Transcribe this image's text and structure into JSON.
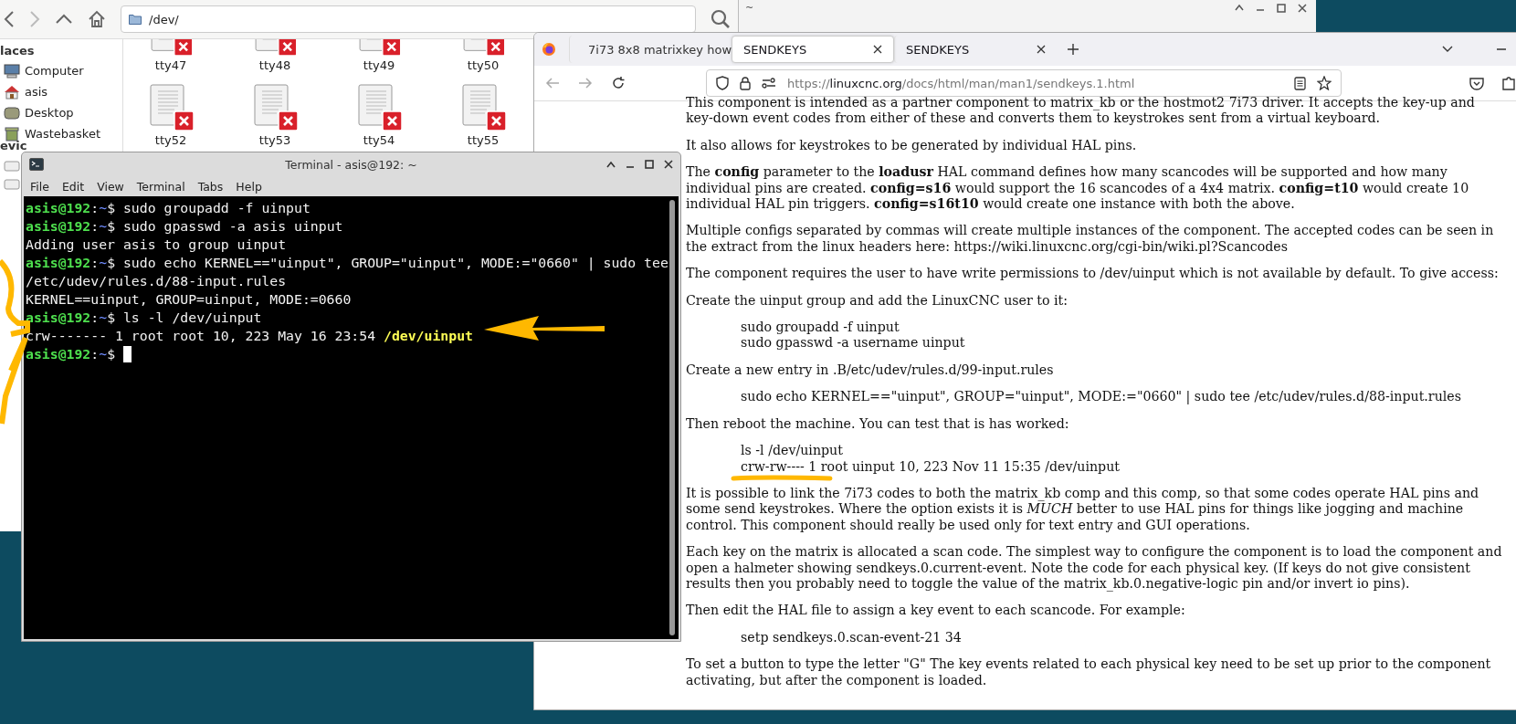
{
  "background_window": {
    "text": "~"
  },
  "file_manager": {
    "path": "/dev/",
    "sidebar": {
      "header": "laces",
      "items": [
        {
          "label": "Computer",
          "kind": "computer"
        },
        {
          "label": "asis",
          "kind": "home"
        },
        {
          "label": "Desktop",
          "kind": "desktop"
        },
        {
          "label": "Wastebasket",
          "kind": "trash"
        }
      ],
      "header2": "evic"
    },
    "files": [
      {
        "name": "tty47"
      },
      {
        "name": "tty48"
      },
      {
        "name": "tty49"
      },
      {
        "name": "tty50"
      },
      {
        "name": "tty52"
      },
      {
        "name": "tty53"
      },
      {
        "name": "tty54"
      },
      {
        "name": "tty55"
      }
    ]
  },
  "terminal": {
    "title": "Terminal - asis@192: ~",
    "menu": [
      "File",
      "Edit",
      "View",
      "Terminal",
      "Tabs",
      "Help"
    ],
    "lines": [
      {
        "kind": "prompt",
        "user": "asis@192",
        "colon": ":",
        "dir": "~",
        "sign": "$",
        "command": "sudo groupadd -f uinput"
      },
      {
        "kind": "prompt",
        "user": "asis@192",
        "colon": ":",
        "dir": "~",
        "sign": "$",
        "command": "sudo gpasswd -a asis uinput"
      },
      {
        "kind": "output",
        "text": "Adding user asis to group uinput"
      },
      {
        "kind": "prompt",
        "user": "asis@192",
        "colon": ":",
        "dir": "~",
        "sign": "$",
        "command": "sudo echo KERNEL==\"uinput\", GROUP=\"uinput\", MODE:=\"0660\" | sudo tee"
      },
      {
        "kind": "output",
        "text": "/etc/udev/rules.d/88-input.rules"
      },
      {
        "kind": "output",
        "text": "KERNEL==uinput, GROUP=uinput, MODE:=0660"
      },
      {
        "kind": "prompt",
        "user": "asis@192",
        "colon": ":",
        "dir": "~",
        "sign": "$",
        "command": "ls -l /dev/uinput"
      },
      {
        "kind": "listing",
        "text": "crw------- 1 root root 10, 223 May 16 23:54",
        "file": "/dev/uinput"
      },
      {
        "kind": "prompt",
        "user": "asis@192",
        "colon": ":",
        "dir": "~",
        "sign": "$",
        "cursor": true
      }
    ]
  },
  "browser": {
    "tabs": [
      {
        "title": "7i73 8x8 matrixkey how",
        "selected": false
      },
      {
        "title": "SENDKEYS",
        "selected": true
      },
      {
        "title": "SENDKEYS",
        "selected": false
      }
    ],
    "url": {
      "scheme": "https://",
      "host": "linuxcnc.org",
      "path": "/docs/html/man/man1/sendkeys.1.html"
    },
    "content": [
      {
        "kind": "p",
        "text": "This component is intended as a partner component to matrix_kb or the hostmot2 7i73 driver. It accepts the key-up and key-down event codes from either of these and converts them to keystrokes sent from a virtual keyboard."
      },
      {
        "kind": "p",
        "text": "It also allows for keystrokes to be generated by individual HAL pins."
      },
      {
        "kind": "p",
        "text": "The **config** parameter to the **loadusr** HAL command defines how many scancodes will be supported and how many individual pins are created. **config=s16** would support the 16 scancodes of a 4x4 matrix. **config=t10** would create 10 individual HAL pin triggers. **config=s16t10** would create one instance with both the above."
      },
      {
        "kind": "p",
        "text": "Multiple configs separated by commas will create multiple instances of the component. The accepted codes can be seen in the extract from the linux headers here: https://wiki.linuxcnc.org/cgi-bin/wiki.pl?Scancodes"
      },
      {
        "kind": "p",
        "text": "The component requires the user to have write permissions to /dev/uinput which is not available by default. To give access:"
      },
      {
        "kind": "p",
        "text": "Create the uinput group and add the LinuxCNC user to it:"
      },
      {
        "kind": "code",
        "lines": [
          "sudo groupadd -f uinput",
          "sudo gpasswd -a username uinput"
        ]
      },
      {
        "kind": "p",
        "text": "Create a new entry in .B/etc/udev/rules.d/99-input.rules"
      },
      {
        "kind": "code",
        "lines": [
          "sudo echo KERNEL==\"uinput\", GROUP=\"uinput\", MODE:=\"0660\" | sudo tee /etc/udev/rules.d/88-input.rules"
        ]
      },
      {
        "kind": "p",
        "text": "Then reboot the machine. You can test that is has worked:"
      },
      {
        "kind": "code",
        "lines": [
          "ls -l /dev/uinput",
          "crw-rw---- 1 root uinput 10, 223 Nov 11 15:35 /dev/uinput"
        ]
      },
      {
        "kind": "p",
        "text": "It is possible to link the 7i73 codes to both the matrix_kb comp and this comp, so that some codes operate HAL pins and some send keystrokes. Where the option exists it is *MUCH* better to use HAL pins for things like jogging and machine control. This component should really be used only for text entry and GUI operations."
      },
      {
        "kind": "p",
        "text": "Each key on the matrix is allocated a scan code. The simplest way to configure the component is to load the component and open a halmeter showing sendkeys.0.current-event. Note the code for each physical key. (If keys do not give consistent results then you probably need to toggle the value of the matrix_kb.0.negative-logic pin and/or invert io pins)."
      },
      {
        "kind": "p",
        "text": "Then edit the HAL file to assign a key event to each scancode. For example:"
      },
      {
        "kind": "code",
        "lines": [
          "setp sendkeys.0.scan-event-21 34"
        ]
      },
      {
        "kind": "p",
        "text": "To set a button to type the letter \"G\" The key events related to each physical key need to be set up prior to the component activating, but after the component is loaded."
      }
    ]
  }
}
